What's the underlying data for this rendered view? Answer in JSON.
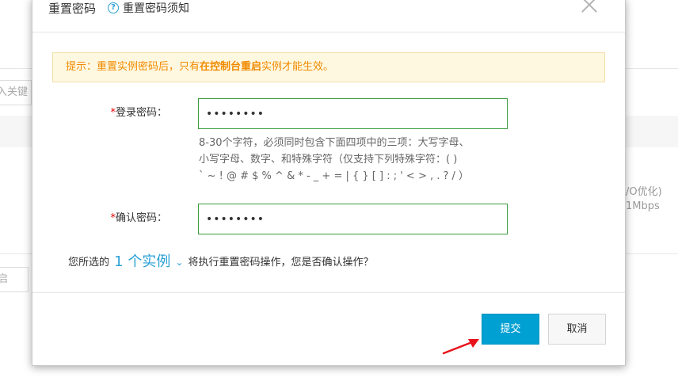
{
  "background": {
    "search_partial": "入关键",
    "button_partial": "启",
    "row_text_1": "/O优化)",
    "row_text_2": "1Mbps"
  },
  "dialog": {
    "title": "重置密码",
    "help_icon": "question-circle-icon",
    "help_link": "重置密码须知",
    "close_icon": "close-icon",
    "notice": {
      "prefix": "提示：重置实例密码后，只有",
      "bold": "在控制台重启",
      "suffix": "实例才能生效。"
    },
    "login_password": {
      "required_mark": "*",
      "label": "登录密码：",
      "value": "••••••••"
    },
    "hint_lines": [
      "8-30个字符，必须同时包含下面四项中的三项：大写字母、",
      "小写字母、数字、和特殊字符（仅支持下列特殊字符：( )",
      "` ~ ! @ # $ % ^ & * - _ + = | { } [ ] : ; ' < > , . ? /  ）"
    ],
    "confirm_password": {
      "required_mark": "*",
      "label": "确认密码：",
      "value": "••••••••"
    },
    "confirm_prefix": "您所选的",
    "instance_link": "1 个实例",
    "chevron_icon": "chevron-down-icon",
    "confirm_suffix": "将执行重置密码操作，您是否确认操作？",
    "submit_label": "提交",
    "cancel_label": "取消"
  },
  "colors": {
    "accent": "#00a0d2",
    "notice_text": "#f08a00",
    "notice_bg": "#fff8e1",
    "required": "#e60000",
    "input_border": "#3c9b3c",
    "arrow": "#e8141c"
  }
}
